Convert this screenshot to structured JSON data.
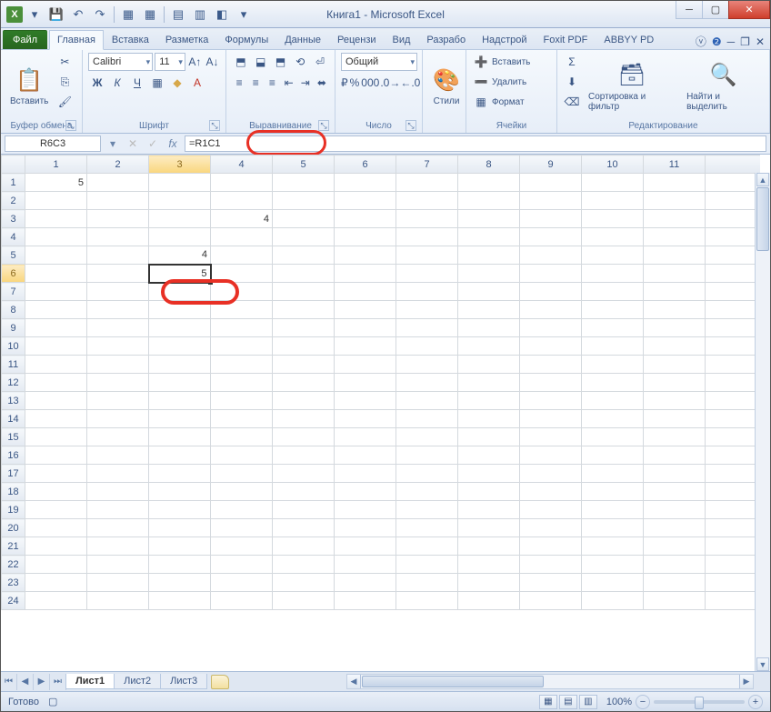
{
  "title": "Книга1  -  Microsoft Excel",
  "qat_icon": "X",
  "tabs": {
    "file": "Файл",
    "items": [
      "Главная",
      "Вставка",
      "Разметка",
      "Формулы",
      "Данные",
      "Рецензи",
      "Вид",
      "Разрабо",
      "Надстрой",
      "Foxit PDF",
      "ABBYY PD"
    ],
    "active": 0
  },
  "ribbon": {
    "clipboard": {
      "paste": "Вставить",
      "label": "Буфер обмена"
    },
    "font": {
      "name": "Calibri",
      "size": "11",
      "label": "Шрифт"
    },
    "align": {
      "label": "Выравнивание"
    },
    "number": {
      "format": "Общий",
      "label": "Число"
    },
    "styles": {
      "btn": "Стили"
    },
    "cells": {
      "insert": "Вставить",
      "delete": "Удалить",
      "format": "Формат",
      "label": "Ячейки"
    },
    "editing": {
      "sort": "Сортировка и фильтр",
      "find": "Найти и выделить",
      "label": "Редактирование"
    }
  },
  "namebox": "R6C3",
  "formula": "=R1C1",
  "columns": [
    "1",
    "2",
    "3",
    "4",
    "5",
    "6",
    "7",
    "8",
    "9",
    "10",
    "11"
  ],
  "rows_count": 24,
  "cells": {
    "r1c1": "5",
    "r3c4": "4",
    "r5c3": "4",
    "r6c3": "5"
  },
  "active": {
    "row": 6,
    "col": 3
  },
  "sheets": {
    "items": [
      "Лист1",
      "Лист2",
      "Лист3"
    ],
    "active": 0
  },
  "status": {
    "ready": "Готово",
    "zoom": "100%"
  }
}
